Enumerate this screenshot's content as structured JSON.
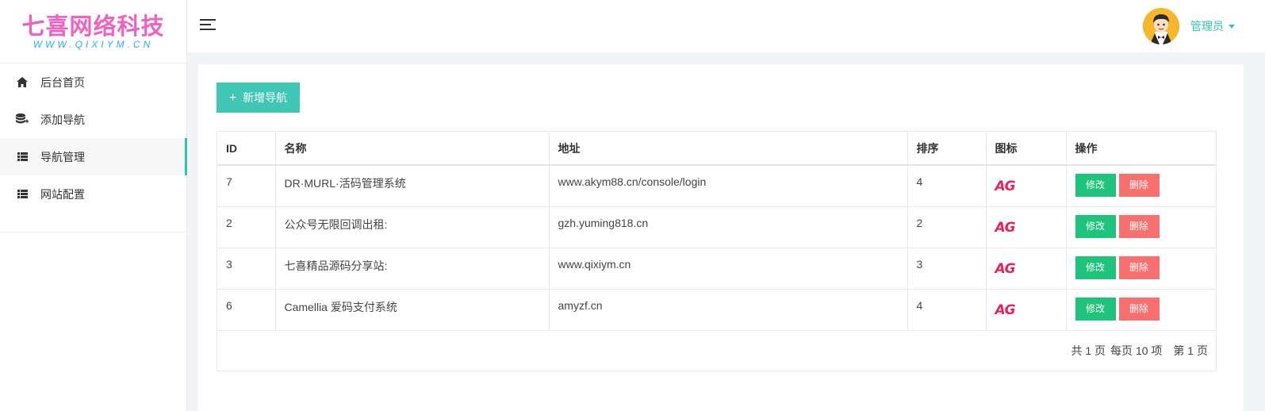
{
  "logo": {
    "title": "七喜网络科技",
    "subtitle": "WWW.QIXIYM.CN"
  },
  "sidebar": {
    "items": [
      {
        "label": "后台首页",
        "icon": "home-icon",
        "active": false
      },
      {
        "label": "添加导航",
        "icon": "database-add-icon",
        "active": false
      },
      {
        "label": "导航管理",
        "icon": "list-icon",
        "active": true
      },
      {
        "label": "网站配置",
        "icon": "list-icon",
        "active": false
      }
    ]
  },
  "header": {
    "username": "管理员"
  },
  "toolbar": {
    "add_label": "新增导航",
    "add_icon": "+"
  },
  "table": {
    "columns": [
      "ID",
      "名称",
      "地址",
      "排序",
      "图标",
      "操作"
    ],
    "icon_text": "AG",
    "edit_label": "修改",
    "delete_label": "删除",
    "rows": [
      {
        "id": "7",
        "name": "DR·MURL·活码管理系统",
        "url": "www.akym88.cn/console/login",
        "sort": "4"
      },
      {
        "id": "2",
        "name": "公众号无限回调出租:",
        "url": "gzh.yuming818.cn",
        "sort": "2"
      },
      {
        "id": "3",
        "name": "七喜精品源码分享站:",
        "url": "www.qixiym.cn",
        "sort": "3"
      },
      {
        "id": "6",
        "name": "Camellia 爱码支付系统",
        "url": "amyzf.cn",
        "sort": "4"
      }
    ]
  },
  "pager": {
    "total_pages": "共 1 页",
    "per_page": "每页 10 项",
    "current": "第 1 页"
  },
  "colors": {
    "accent": "#2ec5b4",
    "edit": "#1fc37b",
    "delete": "#f76f6f",
    "logo": "#f062c0"
  }
}
